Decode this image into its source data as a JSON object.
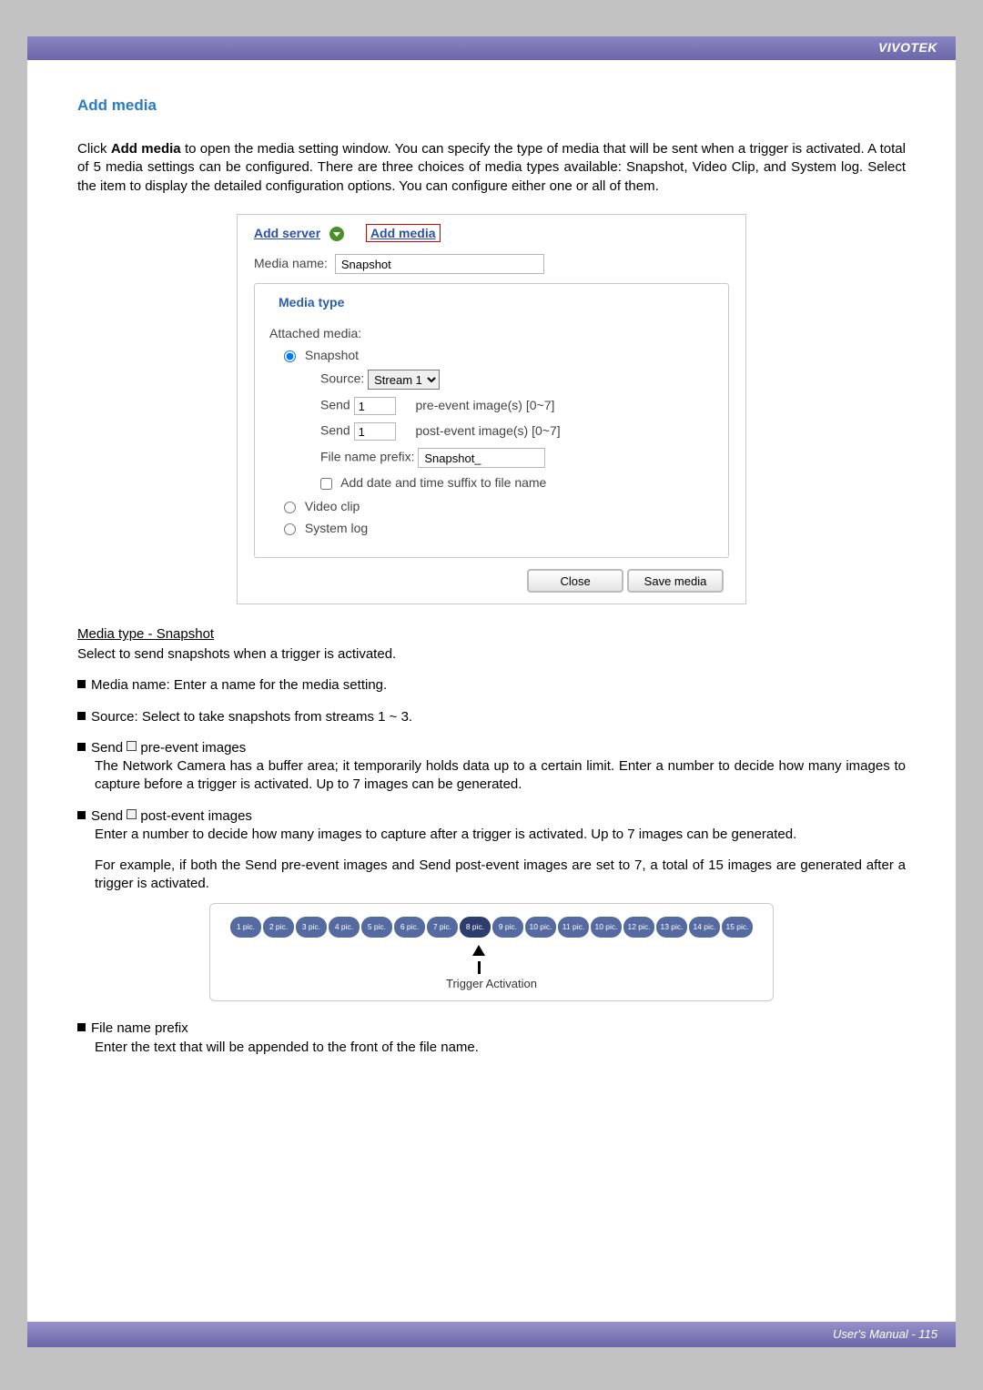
{
  "brand": "VIVOTEK",
  "section_title": "Add media",
  "intro_prefix": "Click ",
  "intro_bold": "Add media",
  "intro_suffix": " to open the media setting window. You can specify the type of media that will be sent when a trigger is activated. A total of 5 media settings can be configured. There are three choices of media types available: Snapshot, Video Clip, and System log. Select the item to display the detailed configuration options. You can configure either one or all of them.",
  "panel": {
    "add_server_link": "Add server",
    "add_media_link": "Add media",
    "media_name_label": "Media name:",
    "media_name_value": "Snapshot",
    "media_type_legend": "Media type",
    "attached_label": "Attached media:",
    "radio_snapshot": "Snapshot",
    "radio_video": "Video clip",
    "radio_system": "System log",
    "source_label": "Source:",
    "source_value": "Stream 1",
    "send_label_a": "Send",
    "send_val_a": "1",
    "send_suffix_a": "pre-event image(s) [0~7]",
    "send_label_b": "Send",
    "send_val_b": "1",
    "send_suffix_b": "post-event image(s) [0~7]",
    "file_prefix_label": "File name prefix:",
    "file_prefix_value": "Snapshot_",
    "add_date_label": "Add date and time suffix to file name",
    "close_btn": "Close",
    "save_btn": "Save media"
  },
  "body": {
    "snapshot_heading": "Media type - Snapshot",
    "snapshot_para": "Select to send snapshots when a trigger is activated.",
    "li1": "Media name: Enter a name for the media setting.",
    "li2": "Source: Select to take snapshots from streams 1 ~ 3.",
    "li3_a": "Send ",
    "li3_b": " pre-event images",
    "li3_body": "The Network Camera has a buffer area; it temporarily holds data up to a certain limit. Enter a number to decide how many images to capture before a trigger is activated. Up to 7 images can be generated.",
    "li4_a": "Send ",
    "li4_b": " post-event images",
    "li4_body": "Enter a number to decide how many images to capture after a trigger is activated. Up to 7 images can be generated.",
    "li4_body2": "For example, if both the Send pre-event images and Send post-event images are set to 7, a total of 15 images are generated after a trigger is activated.",
    "li5_a": "File name prefix",
    "li5_body": "Enter the text that will be appended to the front of the file name."
  },
  "diagram": {
    "pics": [
      "1 pic.",
      "2 pic.",
      "3 pic.",
      "4 pic.",
      "5 pic.",
      "6 pic.",
      "7 pic.",
      "8 pic.",
      "9 pic.",
      "10 pic.",
      "11 pic.",
      "10 pic.",
      "12 pic.",
      "13 pic.",
      "14 pic.",
      "15 pic."
    ],
    "trigger_label": "Trigger Activation"
  },
  "footer": "User's Manual - 115"
}
